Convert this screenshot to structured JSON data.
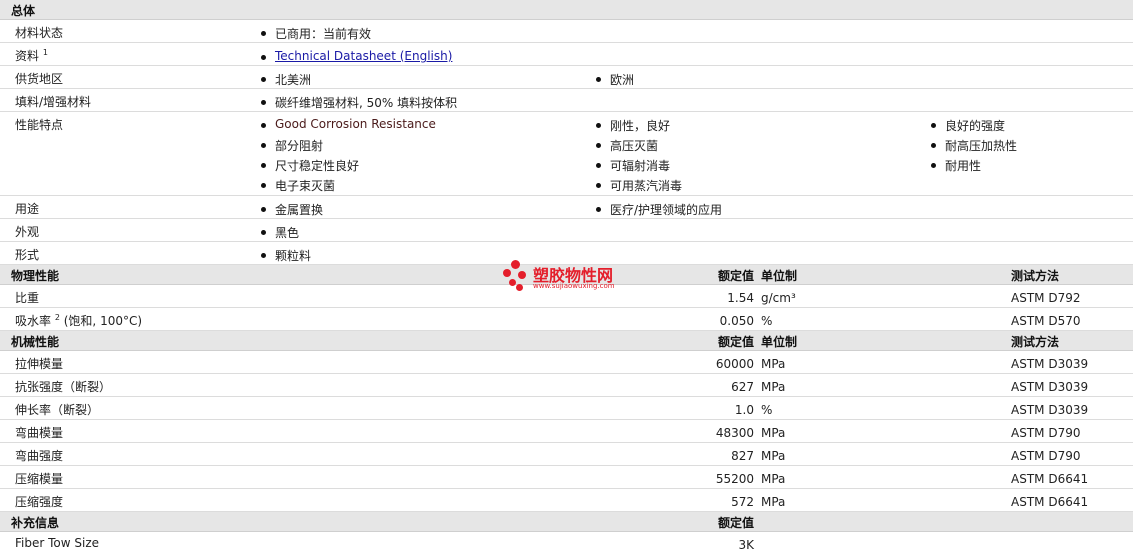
{
  "general": {
    "title": "总体",
    "material_status": {
      "label": "材料状态",
      "items": [
        "已商用：当前有效"
      ]
    },
    "documents": {
      "label": "资料",
      "sup": "1",
      "link": "Technical Datasheet (English)"
    },
    "availability": {
      "label": "供货地区",
      "items": [
        "北美洲",
        "欧洲"
      ]
    },
    "filler": {
      "label": "填料/增强材料",
      "items": [
        "碳纤维增强材料, 50% 填料按体积"
      ]
    },
    "features": {
      "label": "性能特点",
      "col1": [
        "Good Corrosion Resistance",
        "部分阻射",
        "尺寸稳定性良好",
        "电子束灭菌"
      ],
      "col2": [
        "刚性，良好",
        "高压灭菌",
        "可辐射消毒",
        "可用蒸汽消毒"
      ],
      "col3": [
        "良好的强度",
        "耐高压加热性",
        "耐用性"
      ]
    },
    "uses": {
      "label": "用途",
      "items": [
        "金属置换",
        "医疗/护理领域的应用"
      ]
    },
    "appearance": {
      "label": "外观",
      "items": [
        "黑色"
      ]
    },
    "form": {
      "label": "形式",
      "items": [
        "颗粒料"
      ]
    }
  },
  "headers": {
    "value": "额定值",
    "unit": "单位制",
    "method": "测试方法"
  },
  "physical": {
    "title": "物理性能",
    "rows": [
      {
        "label": "比重",
        "value": "1.54",
        "unit": "g/cm³",
        "method": "ASTM D792"
      },
      {
        "label": "吸水率",
        "sup": "2",
        "suffix": " (饱和, 100°C)",
        "value": "0.050",
        "unit": "%",
        "method": "ASTM D570"
      }
    ]
  },
  "mechanical": {
    "title": "机械性能",
    "rows": [
      {
        "label": "拉伸模量",
        "value": "60000",
        "unit": "MPa",
        "method": "ASTM D3039"
      },
      {
        "label": "抗张强度（断裂）",
        "value": "627",
        "unit": "MPa",
        "method": "ASTM D3039"
      },
      {
        "label": "伸长率（断裂）",
        "value": "1.0",
        "unit": "%",
        "method": "ASTM D3039"
      },
      {
        "label": "弯曲模量",
        "value": "48300",
        "unit": "MPa",
        "method": "ASTM D790"
      },
      {
        "label": "弯曲强度",
        "value": "827",
        "unit": "MPa",
        "method": "ASTM D790"
      },
      {
        "label": "压缩模量",
        "value": "55200",
        "unit": "MPa",
        "method": "ASTM D6641"
      },
      {
        "label": "压缩强度",
        "value": "572",
        "unit": "MPa",
        "method": "ASTM D6641"
      }
    ]
  },
  "supplemental": {
    "title": "补充信息",
    "rows": [
      {
        "label": "Fiber Tow Size",
        "value": "3K"
      }
    ]
  },
  "watermark": {
    "cn": "塑胶物性网",
    "en": "www.sujiaowuxing.com",
    "color": "#e41e2b"
  }
}
